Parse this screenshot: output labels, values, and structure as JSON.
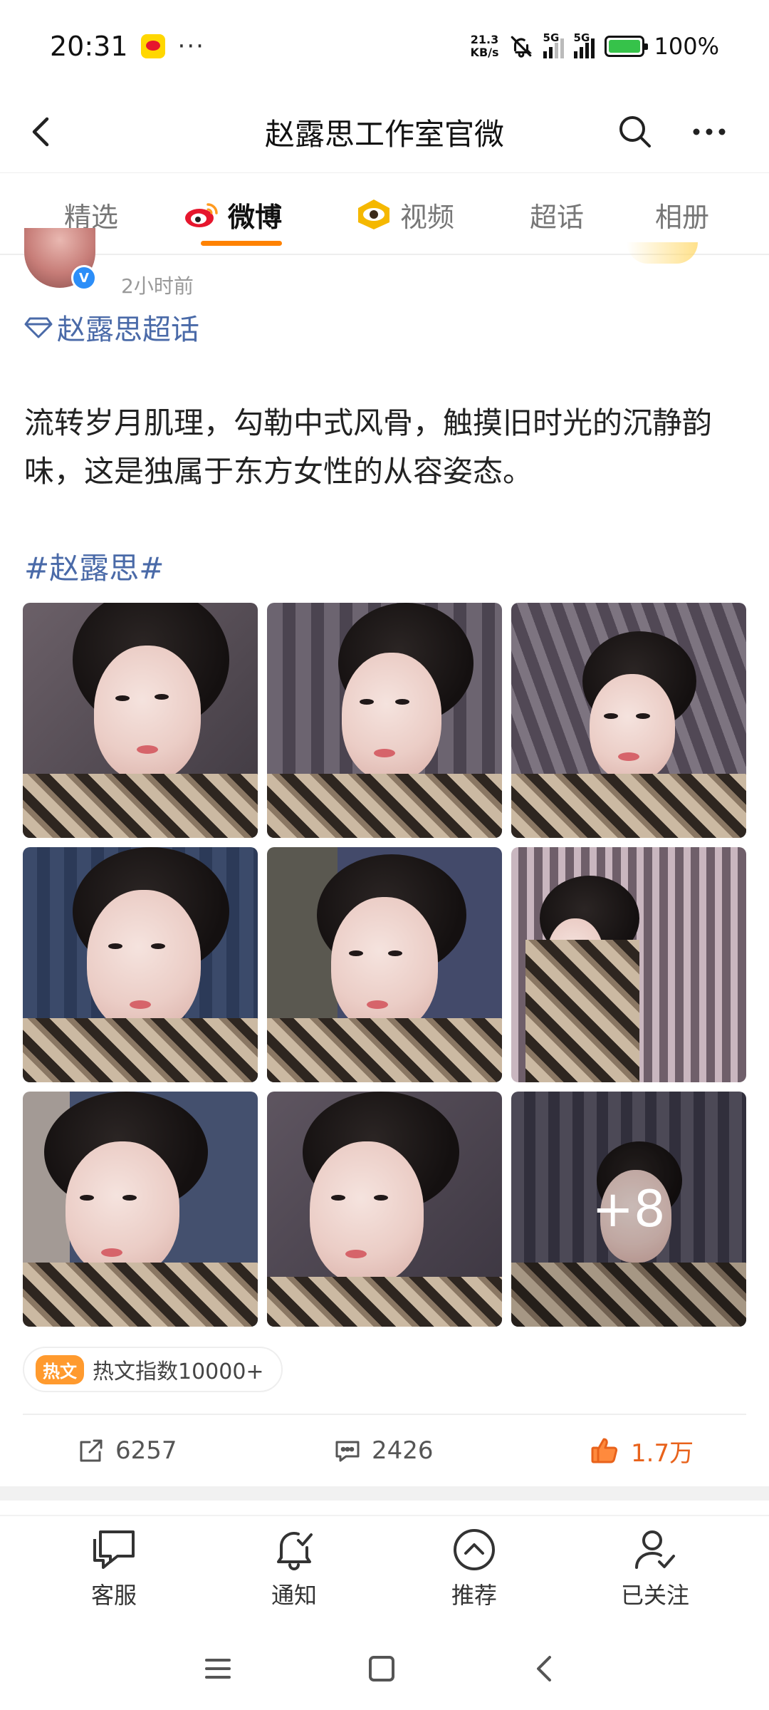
{
  "status_bar": {
    "time": "20:31",
    "dots": "···",
    "net_speed_value": "21.3",
    "net_speed_unit": "KB/s",
    "sim1": "5G",
    "sim2": "5G",
    "battery": "100%"
  },
  "header": {
    "title": "赵露思工作室官微",
    "back_icon": "chevron-left-icon",
    "search_icon": "search-icon",
    "more_icon": "more-horizontal-icon"
  },
  "tabs": [
    {
      "label": "精选"
    },
    {
      "label": "微博",
      "icon": "weibo-logo-icon"
    },
    {
      "label": "视频",
      "icon": "video-eye-icon"
    },
    {
      "label": "超话"
    },
    {
      "label": "相册"
    }
  ],
  "post": {
    "time": "2小时前",
    "super_topic": "赵露思超话",
    "text": "流转岁月肌理，勾勒中式风骨，触摸旧时光的沉静韵味，这是独属于东方女性的从容姿态。",
    "hashtag": "#赵露思#",
    "more_images": "+8",
    "hot_tag": "热文",
    "hot_text": "热文指数10000+",
    "reposts": "6257",
    "comments": "2426",
    "likes": "1.7万"
  },
  "bottom_nav": [
    {
      "label": "客服",
      "icon": "chat-bubble-icon"
    },
    {
      "label": "通知",
      "icon": "bell-check-icon"
    },
    {
      "label": "推荐",
      "icon": "arrow-up-circle-icon"
    },
    {
      "label": "已关注",
      "icon": "user-check-icon"
    }
  ],
  "colors": {
    "accent": "#ff8200",
    "link": "#4a6aa8",
    "like": "#e8621b",
    "verified": "#2c8ef8"
  }
}
